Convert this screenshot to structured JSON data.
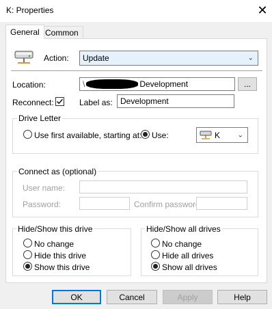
{
  "window": {
    "title": "K: Properties",
    "close_glyph": "✕"
  },
  "tabs": [
    {
      "label": "General",
      "active": true
    },
    {
      "label": "Common",
      "active": false
    }
  ],
  "action": {
    "label": "Action:",
    "value": "Update"
  },
  "location": {
    "label": "Location:",
    "value_prefix": "\\",
    "value_suffix": "Development",
    "browse_label": "..."
  },
  "reconnect": {
    "label": "Reconnect:",
    "checked": true
  },
  "label_as": {
    "label": "Label as:",
    "value": "Development"
  },
  "drive_letter": {
    "title": "Drive Letter",
    "use_first_label": "Use first available, starting at:",
    "use_label": "Use:",
    "selected": "use",
    "drive_value": "K"
  },
  "connect_as": {
    "title": "Connect as (optional)",
    "username_label": "User name:",
    "password_label": "Password:",
    "confirm_label": "Confirm password:"
  },
  "hide_show_drive": {
    "title": "Hide/Show this drive",
    "options": [
      "No change",
      "Hide this drive",
      "Show this drive"
    ],
    "selected_index": 2
  },
  "hide_show_all": {
    "title": "Hide/Show all drives",
    "options": [
      "No change",
      "Hide all drives",
      "Show all drives"
    ],
    "selected_index": 2
  },
  "buttons": {
    "ok": "OK",
    "cancel": "Cancel",
    "apply": "Apply",
    "help": "Help"
  },
  "colors": {
    "accent": "#0078d7",
    "dialog_bg": "#f0f0f0",
    "select_bg": "#e5f1fb"
  }
}
